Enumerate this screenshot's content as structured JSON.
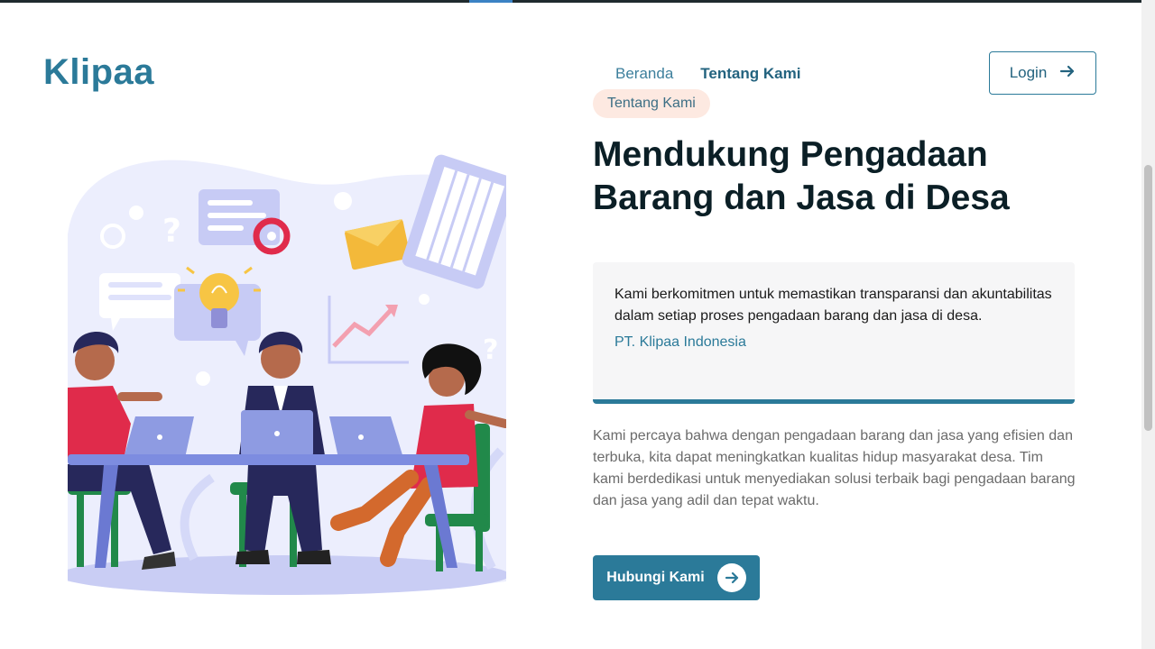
{
  "brand": {
    "logo_text": "Klipaa",
    "accent": "#2b7a99"
  },
  "nav": {
    "items": [
      {
        "label": "Beranda"
      },
      {
        "label": "Tentang Kami"
      }
    ],
    "login_label": "Login",
    "login_icon": "arrow-right-icon"
  },
  "hero": {
    "tag": "Tentang Kami",
    "headline": "Mendukung Pengadaan Barang dan Jasa di Desa",
    "quote": {
      "text": "Kami berkomitmen untuk memastikan transparansi dan akuntabilitas dalam setiap proses pengadaan barang dan jasa di desa.",
      "author": "PT. Klipaa Indonesia"
    },
    "description": "Kami percaya bahwa dengan pengadaan barang dan jasa yang efisien dan terbuka, kita dapat meningkatkan kualitas hidup masyarakat desa. Tim kami berdedikasi untuk menyediakan solusi terbaik bagi pengadaan barang dan jasa yang adil dan tepat waktu.",
    "cta_label": "Hubungi Kami",
    "cta_icon": "arrow-circle-right-icon"
  },
  "illustration": {
    "subject": "team-meeting-illustration"
  }
}
